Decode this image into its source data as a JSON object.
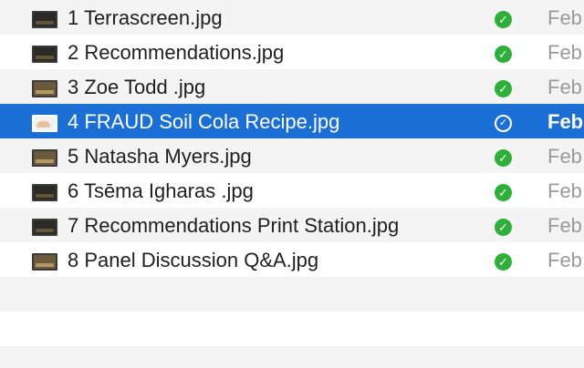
{
  "files": [
    {
      "name": "1 Terrascreen.jpg",
      "status_icon": "checkmark-circle",
      "date": "Feb"
    },
    {
      "name": "2 Recommendations.jpg",
      "status_icon": "checkmark-circle",
      "date": "Feb"
    },
    {
      "name": "3 Zoe Todd .jpg",
      "status_icon": "checkmark-circle",
      "date": "Feb"
    },
    {
      "name": "4 FRAUD Soil Cola Recipe.jpg",
      "status_icon": "checkmark-circle",
      "date": "Feb",
      "selected": true
    },
    {
      "name": "5 Natasha Myers.jpg",
      "status_icon": "checkmark-circle",
      "date": "Feb"
    },
    {
      "name": "6 Tsēma Igharas .jpg",
      "status_icon": "checkmark-circle",
      "date": "Feb"
    },
    {
      "name": "7 Recommendations Print Station.jpg",
      "status_icon": "checkmark-circle",
      "date": "Feb"
    },
    {
      "name": "8 Panel Discussion Q&A.jpg",
      "status_icon": "checkmark-circle",
      "date": "Feb"
    }
  ],
  "colors": {
    "selection": "#1b6fd4",
    "status_synced": "#2eaf3a",
    "row_alt": "#f4f4f5",
    "date_text": "#9a9a9a"
  }
}
